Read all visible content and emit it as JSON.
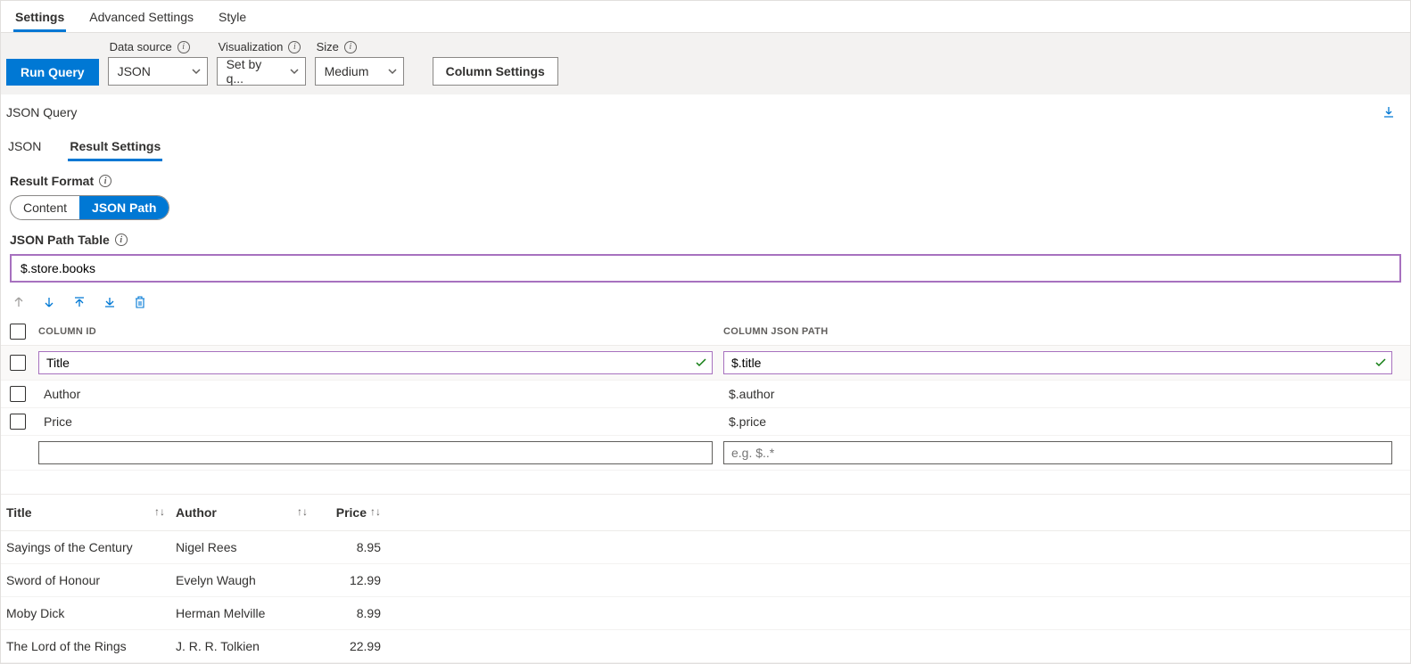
{
  "top_tabs": [
    "Settings",
    "Advanced Settings",
    "Style"
  ],
  "toolbar": {
    "run_label": "Run Query",
    "data_source_label": "Data source",
    "data_source_value": "JSON",
    "visualization_label": "Visualization",
    "visualization_value": "Set by q...",
    "size_label": "Size",
    "size_value": "Medium",
    "column_settings_label": "Column Settings"
  },
  "json_query_label": "JSON Query",
  "inner_tabs": [
    "JSON",
    "Result Settings"
  ],
  "result_format_label": "Result Format",
  "pills": {
    "content": "Content",
    "json_path": "JSON Path"
  },
  "json_path_table_label": "JSON Path Table",
  "json_path_table_value": "$.store.books",
  "col_headers": {
    "id": "COLUMN ID",
    "path": "COLUMN JSON PATH"
  },
  "columns": [
    {
      "id": "Title",
      "path": "$.title",
      "selected": true
    },
    {
      "id": "Author",
      "path": "$.author",
      "selected": false
    },
    {
      "id": "Price",
      "path": "$.price",
      "selected": false
    }
  ],
  "placeholders": {
    "id": "",
    "path": "e.g. $..*"
  },
  "results": {
    "headers": [
      "Title",
      "Author",
      "Price"
    ],
    "rows": [
      {
        "title": "Sayings of the Century",
        "author": "Nigel Rees",
        "price": "8.95"
      },
      {
        "title": "Sword of Honour",
        "author": "Evelyn Waugh",
        "price": "12.99"
      },
      {
        "title": "Moby Dick",
        "author": "Herman Melville",
        "price": "8.99"
      },
      {
        "title": "The Lord of the Rings",
        "author": "J. R. R. Tolkien",
        "price": "22.99"
      }
    ]
  }
}
